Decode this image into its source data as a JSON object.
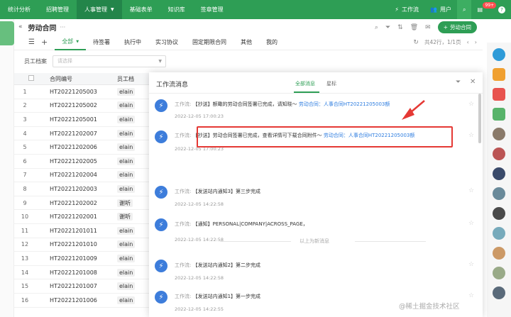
{
  "topnav": {
    "items": [
      "统计分析",
      "招聘管理",
      "人事管理",
      "基础表单",
      "知识库",
      "签章管理"
    ],
    "workflow": "工作流",
    "user": "用户",
    "msg_badge": "99+"
  },
  "titlebar": {
    "title": "劳动合同",
    "ellipsis": "···",
    "add_label": "劳动合同"
  },
  "tabs": [
    "全部",
    "待签署",
    "执行中",
    "实习协议",
    "固定期限合同",
    "其他",
    "我的"
  ],
  "pagination": {
    "total": "共42行，1/1页"
  },
  "filter": {
    "label": "员工档案",
    "placeholder": "请选择"
  },
  "table": {
    "headers": {
      "code": "合同编号",
      "emp": "员工档"
    },
    "rows": [
      {
        "idx": "1",
        "code": "HT20221205003",
        "emp": "elain"
      },
      {
        "idx": "2",
        "code": "HT20221205002",
        "emp": "elain"
      },
      {
        "idx": "3",
        "code": "HT20221205001",
        "emp": "elain"
      },
      {
        "idx": "4",
        "code": "HT20221202007",
        "emp": "elain"
      },
      {
        "idx": "5",
        "code": "HT20221202006",
        "emp": "elain"
      },
      {
        "idx": "6",
        "code": "HT20221202005",
        "emp": "elain"
      },
      {
        "idx": "7",
        "code": "HT20221202004",
        "emp": "elain"
      },
      {
        "idx": "8",
        "code": "HT20221202003",
        "emp": "elain"
      },
      {
        "idx": "9",
        "code": "HT20221202002",
        "emp": "谢听"
      },
      {
        "idx": "10",
        "code": "HT20221202001",
        "emp": "谢听"
      },
      {
        "idx": "11",
        "code": "HT20221201011",
        "emp": "elain"
      },
      {
        "idx": "12",
        "code": "HT20221201010",
        "emp": "elain"
      },
      {
        "idx": "13",
        "code": "HT20221201009",
        "emp": "elain"
      },
      {
        "idx": "14",
        "code": "HT20221201008",
        "emp": "elain"
      },
      {
        "idx": "15",
        "code": "HT20221201007",
        "emp": "elain"
      },
      {
        "idx": "16",
        "code": "HT20221201006",
        "emp": "elain"
      }
    ]
  },
  "panel": {
    "title": "工作流消息",
    "tab_all": "全部消息",
    "tab_star": "星标",
    "divider_text": "以上为新消息",
    "messages": [
      {
        "prefix": "工作流:",
        "body": "【抄送】额瞰的劳动合同签署已完成，请知晓～",
        "link": "劳动合同：人事合同HT20221205003额",
        "time": "2022-12-05 17:00:23"
      },
      {
        "prefix": "工作流:",
        "body": "【抄送】劳动合同签署已完成，查看详情可下载合同附件～",
        "link": "劳动合同：人事合同HT20221205003额",
        "time": "2022-12-05 17:00:23"
      },
      {
        "prefix": "工作流:",
        "body": "【发送站内通知3】第三步完成",
        "link": "",
        "time": "2022-12-05 14:22:58"
      },
      {
        "prefix": "工作流:",
        "body": "【通知】PERSONAL|COMPANY|ACROSS_PAGE，",
        "link": "",
        "time": "2022-12-05 14:22:58"
      },
      {
        "prefix": "工作流:",
        "body": "【发送站内通知2】第二步完成",
        "link": "",
        "time": "2022-12-05 14:22:58"
      },
      {
        "prefix": "工作流:",
        "body": "【发送站内通知1】第一步完成",
        "link": "",
        "time": "2022-12-05 14:22:55"
      }
    ]
  },
  "watermark": "@稀土掘金技术社区",
  "colors": {
    "brand": "#2e9e55",
    "link": "#2f7ee0",
    "highlight": "#e53935",
    "icon_blue": "#3d7ddb"
  }
}
